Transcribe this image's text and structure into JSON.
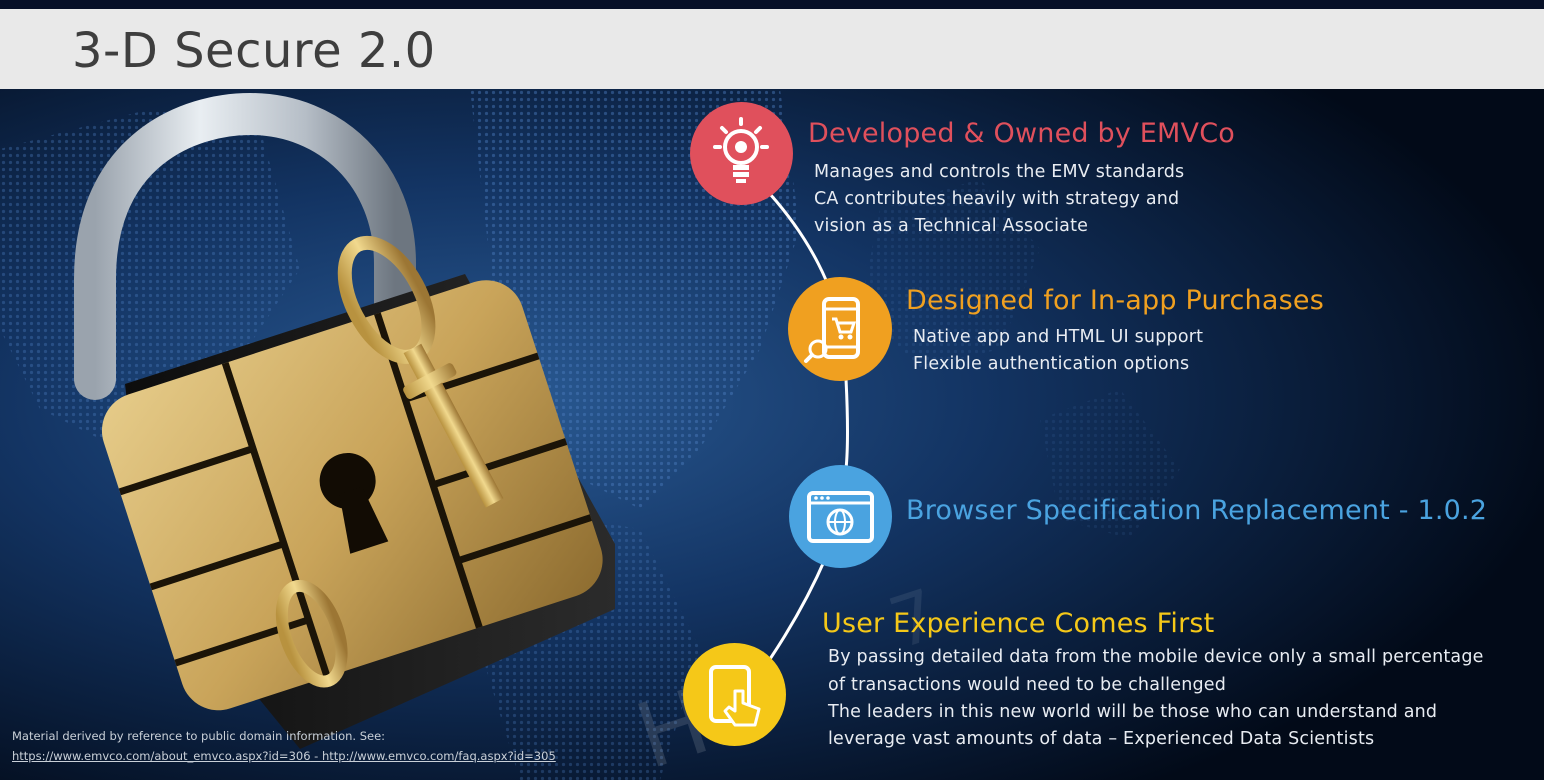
{
  "slide": {
    "title": "3-D Secure 2.0"
  },
  "items": [
    {
      "heading": "Developed & Owned by EMVCo",
      "color": "#e0505c",
      "icon": "lightbulb-gear-icon",
      "lines": [
        "Manages and controls the EMV standards",
        "CA contributes heavily with strategy and",
        "vision as a Technical Associate"
      ]
    },
    {
      "heading": "Designed for In-app Purchases",
      "color": "#f0a020",
      "icon": "phone-cart-icon",
      "lines": [
        "Native app and HTML UI support",
        "Flexible authentication options"
      ]
    },
    {
      "heading": "Browser Specification Replacement - 1.0.2",
      "color": "#4aa3e0",
      "icon": "browser-globe-icon",
      "lines": []
    },
    {
      "heading": "User Experience Comes First",
      "color": "#f5c818",
      "icon": "touch-tablet-icon",
      "lines": [
        "By passing detailed data from the mobile device only a small percentage",
        "of transactions would need to be challenged",
        "The leaders in this new world will be those who can understand and",
        "leverage vast amounts of data – Experienced Data Scientists"
      ]
    }
  ],
  "footer": {
    "note": "Material derived by reference to public domain information. See:",
    "link1": "https://www.emvco.com/about_emvco.aspx?id=306",
    "separator": " - ",
    "link2": "http://www.emvco.com/faq.aspx?id=305"
  },
  "background": {
    "image": "padlock-chip-key-illustration",
    "base_color": "#020a18"
  }
}
